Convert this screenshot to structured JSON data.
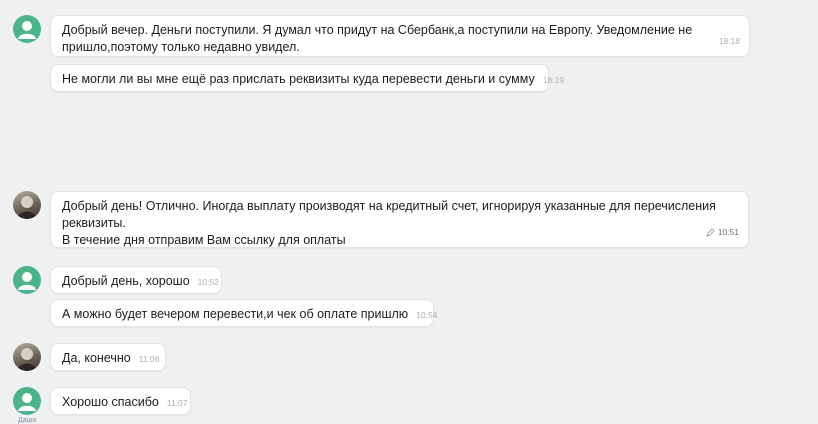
{
  "messages": [
    {
      "text": "Добрый вечер. Деньги поступили. Я думал что придут на Сбербанк,а поступили на Европу. Уведомление не\nпришло,поэтому только недавно увидел.",
      "time": "18:18"
    },
    {
      "text": "Не могли ли вы мне ещё раз прислать реквизиты куда перевести деньги и сумму",
      "time": "18:19"
    },
    {
      "text": "Добрый день! Отлично. Иногда выплату производят на кредитный счет, игнорируя указанные для перечисления\nреквизиты.\nВ течение дня отправим Вам ссылку для оплаты",
      "time": "10:51"
    },
    {
      "text": "Добрый день, хорошо",
      "time": "10:52"
    },
    {
      "text": "А можно будет вечером перевести,и чек об оплате пришлю",
      "time": "10:54"
    },
    {
      "text": "Да, конечно",
      "time": "11:06"
    },
    {
      "text": "Хорошо спасибо",
      "time": "11:07"
    }
  ],
  "bottom_stub": "Даша",
  "colors": {
    "avatar_green": "#4db38a",
    "bubble_bg": "#ffffff",
    "time": "#a8b0b5"
  },
  "icons": {
    "edited": "pencil-icon",
    "default_avatar": "user-icon"
  }
}
